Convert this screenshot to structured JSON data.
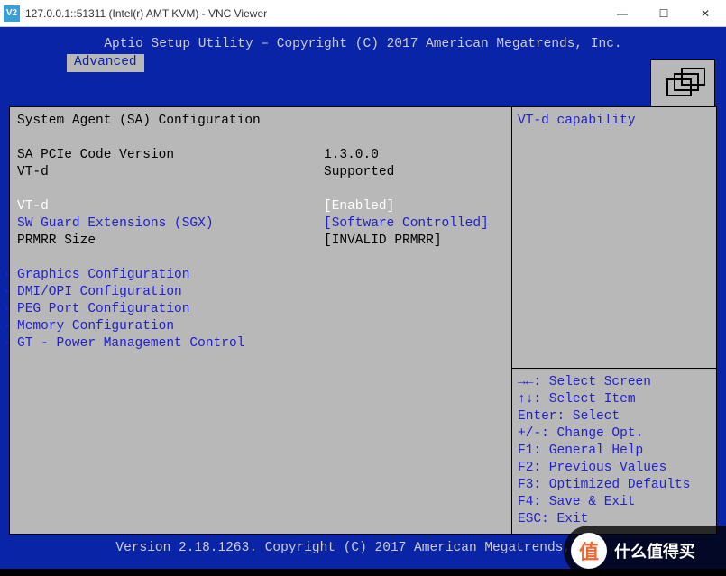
{
  "window": {
    "app_icon_text": "V2",
    "title": "127.0.0.1::51311 (Intel(r) AMT KVM) - VNC Viewer"
  },
  "header": "Aptio Setup Utility – Copyright (C) 2017 American Megatrends, Inc.",
  "tab": "Advanced",
  "left": {
    "title": "System Agent (SA) Configuration",
    "row1_label": "SA PCIe Code Version",
    "row1_value": "1.3.0.0",
    "row2_label": "VT-d",
    "row2_value": "Supported",
    "row3_label": "VT-d",
    "row3_value": "[Enabled]",
    "row4_label": "SW Guard Extensions (SGX)",
    "row4_value": "[Software Controlled]",
    "row5_label": "PRMRR Size",
    "row5_value": "[INVALID PRMRR]",
    "submenus": {
      "0": "Graphics Configuration",
      "1": "DMI/OPI Configuration",
      "2": "PEG Port Configuration",
      "3": "Memory Configuration",
      "4": "GT - Power Management Control"
    }
  },
  "right": {
    "help": "VT-d capability",
    "k0": "→←: Select Screen",
    "k1": "↑↓: Select Item",
    "k2": "Enter: Select",
    "k3": "+/-: Change Opt.",
    "k4": "F1: General Help",
    "k5": "F2: Previous Values",
    "k6": "F3: Optimized Defaults",
    "k7": "F4: Save & Exit",
    "k8": "ESC: Exit"
  },
  "footer": "Version 2.18.1263. Copyright (C) 2017 American Megatrends, Inc.",
  "watermark": "什么值得买"
}
